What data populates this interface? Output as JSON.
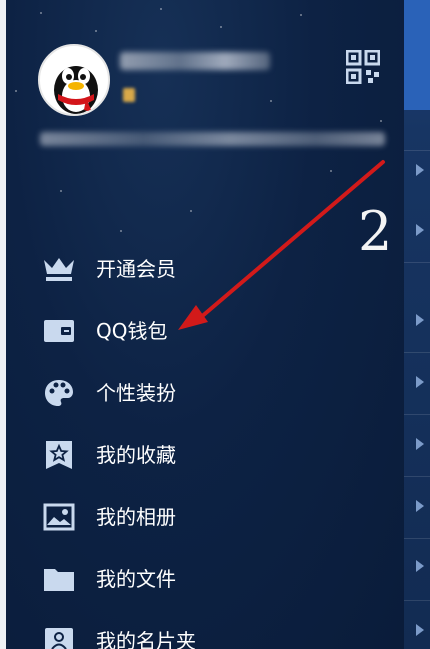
{
  "annotation": {
    "step_number": "2"
  },
  "drawer": {
    "profile": {
      "avatar_icon": "qq-penguin-avatar",
      "qr_icon": "qr-code-icon",
      "name": "",
      "signature": ""
    },
    "menu": [
      {
        "label": "开通会员",
        "icon": "crown-icon"
      },
      {
        "label": "QQ钱包",
        "icon": "wallet-icon"
      },
      {
        "label": "个性装扮",
        "icon": "palette-icon"
      },
      {
        "label": "我的收藏",
        "icon": "star-bookmark-icon"
      },
      {
        "label": "我的相册",
        "icon": "photo-icon"
      },
      {
        "label": "我的文件",
        "icon": "folder-icon"
      },
      {
        "label": "我的名片夹",
        "icon": "contact-card-icon"
      }
    ]
  },
  "colors": {
    "drawer_bg": "#0d2244",
    "icon_color": "#c9d9ee",
    "arrow_color": "#d21a1a",
    "text_color": "#ffffff"
  }
}
